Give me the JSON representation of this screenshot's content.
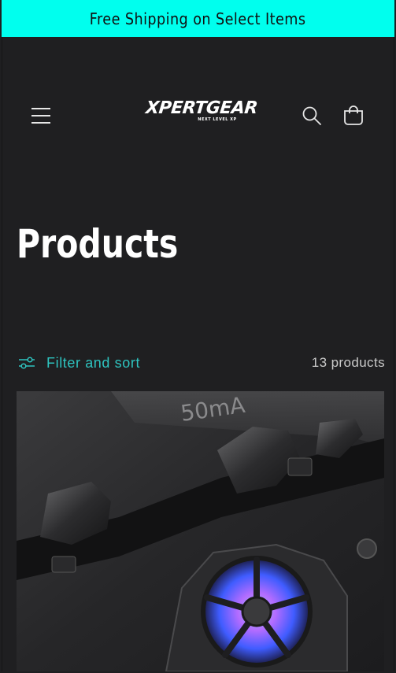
{
  "announcement": {
    "text": "Free Shipping on Select Items",
    "background": "#00ffee"
  },
  "header": {
    "logo_text": "XPERTGEAR",
    "logo_tagline": "NEXT LEVEL XP",
    "icons": {
      "menu": "hamburger-menu-icon",
      "search": "search-icon",
      "cart": "cart-icon"
    }
  },
  "main": {
    "title": "Products",
    "filter_label": "Filter and sort",
    "product_count": "13 products",
    "accent_color": "#2ec4c0"
  },
  "products": [
    {
      "image_text": "50mA"
    }
  ]
}
